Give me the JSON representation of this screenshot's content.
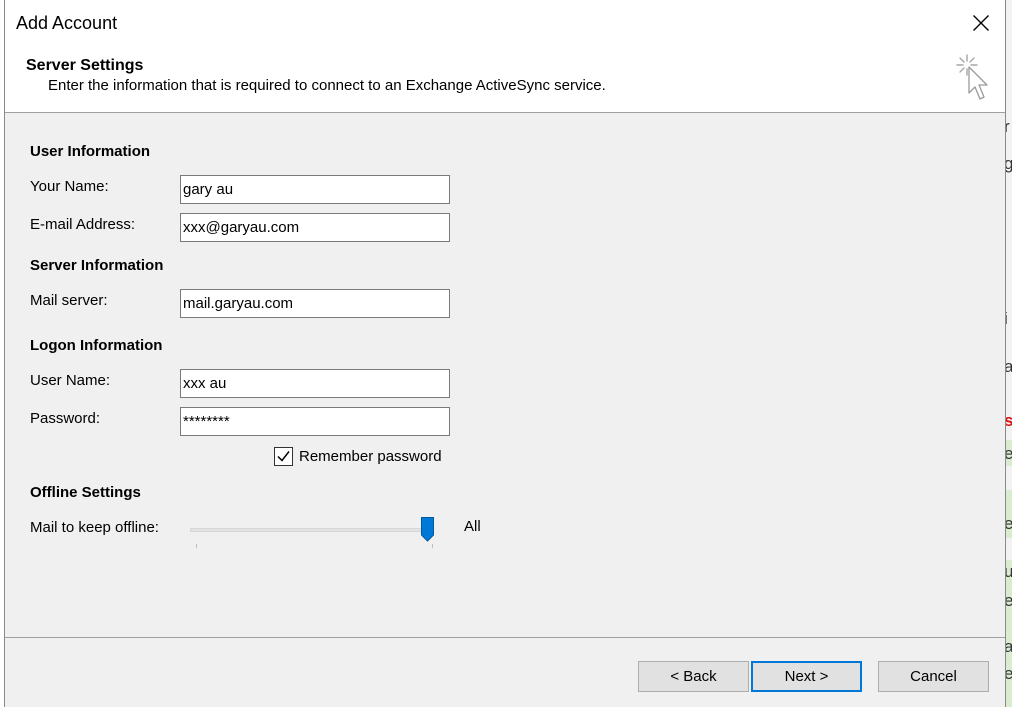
{
  "dialog": {
    "title": "Add Account",
    "close_label": "Close"
  },
  "header": {
    "title": "Server Settings",
    "description": "Enter the information that is required to connect to an Exchange ActiveSync service."
  },
  "user_info": {
    "title": "User Information",
    "name_label": "Your Name:",
    "name_value": "gary au",
    "email_label": "E-mail Address:",
    "email_value": "xxx@garyau.com"
  },
  "server_info": {
    "title": "Server Information",
    "mail_server_label": "Mail server:",
    "mail_server_value": "mail.garyau.com"
  },
  "logon_info": {
    "title": "Logon Information",
    "username_label": "User Name:",
    "username_value": "xxx au",
    "password_label": "Password:",
    "password_value": "********",
    "remember_label": "Remember password",
    "remember_checked": true
  },
  "offline": {
    "title": "Offline Settings",
    "mail_keep_label": "Mail to keep offline:",
    "slider_value_label": "All",
    "slider_position": 1.0
  },
  "buttons": {
    "back": "< Back",
    "next": "Next >",
    "cancel": "Cancel"
  },
  "colors": {
    "accent": "#0078d7",
    "dialog_bg": "#f0f0f0",
    "header_bg": "#ffffff",
    "button_bg": "#e1e1e1"
  },
  "icons": {
    "close": "close-icon",
    "wizard": "cursor-sparkle-icon",
    "checkbox": "checkmark-icon"
  }
}
